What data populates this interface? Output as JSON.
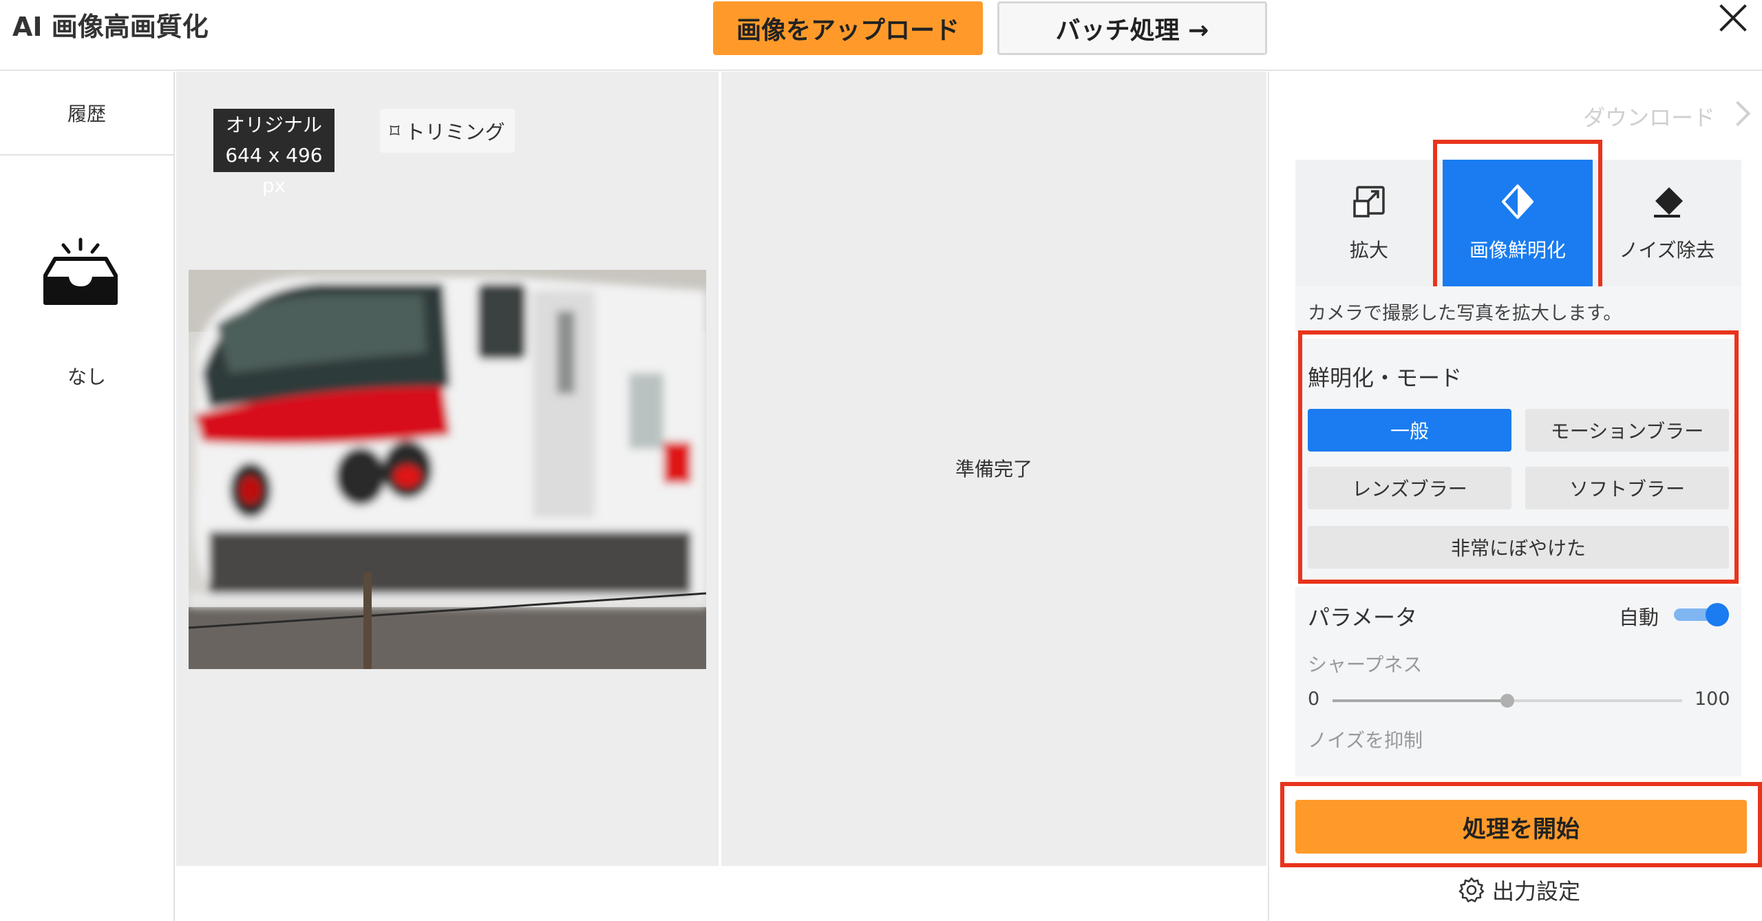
{
  "header": {
    "app_title": "AI 画像高画質化",
    "upload_label": "画像をアップロード",
    "batch_label": "バッチ処理 →",
    "close_icon": "close-icon"
  },
  "sidebar": {
    "history_label": "履歴",
    "empty_icon": "empty-inbox-icon",
    "empty_label": "なし"
  },
  "canvas": {
    "original_label": "オリジナル",
    "original_size": "644 x 496 px",
    "trim_label": "トリミング",
    "trim_icon": "crop-icon",
    "status_text": "準備完了"
  },
  "panel": {
    "download_label": "ダウンロード",
    "tabs": [
      {
        "label": "拡大",
        "icon": "upscale-icon",
        "active": false
      },
      {
        "label": "画像鮮明化",
        "icon": "sharpen-icon",
        "active": true
      },
      {
        "label": "ノイズ除去",
        "icon": "eraser-icon",
        "active": false
      }
    ],
    "description": "カメラで撮影した写真を拡大します。",
    "mode": {
      "title": "鮮明化・モード",
      "options": [
        "一般",
        "モーションブラー",
        "レンズブラー",
        "ソフトブラー",
        "非常にぼやけた"
      ],
      "selected": "一般"
    },
    "parameters": {
      "title": "パラメータ",
      "auto_label": "自動",
      "auto_enabled": true,
      "sharpness": {
        "label": "シャープネス",
        "min": "0",
        "max": "100",
        "value": 50
      },
      "noise_label": "ノイズを抑制"
    },
    "start_label": "処理を開始",
    "output_settings_label": "出力設定",
    "output_settings_icon": "gear-icon"
  },
  "colors": {
    "accent_orange": "#ff9a2a",
    "accent_blue": "#1a7cf0",
    "highlight_red": "#e8341c"
  }
}
